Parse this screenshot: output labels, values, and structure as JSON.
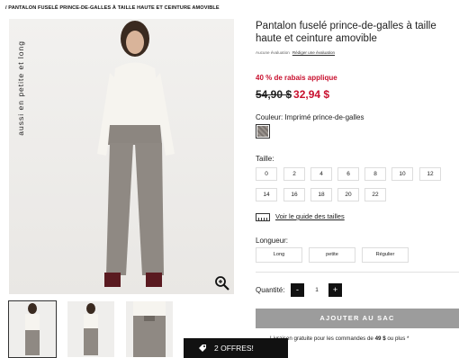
{
  "breadcrumb": "/  PANTALON FUSELÉ PRINCE-DE-GALLES À TAILLE HAUTE ET CEINTURE AMOVIBLE",
  "image": {
    "vertical_label": "aussi en petite et long"
  },
  "product": {
    "title": "Pantalon fuselé prince-de-galles à taille haute et ceinture amovible",
    "review_text": "Aucune évaluation",
    "review_link": "Rédiger une évaluation",
    "promo": "40 % de rabais applique",
    "old_price": "54,90 $",
    "new_price": "32,94 $"
  },
  "color": {
    "label": "Couleur: Imprimé prince-de-galles"
  },
  "sizes": {
    "label": "Taille:",
    "options": [
      "0",
      "2",
      "4",
      "6",
      "8",
      "10",
      "12",
      "14",
      "16",
      "18",
      "20",
      "22"
    ]
  },
  "size_guide": "Voir le guide des tailles",
  "length": {
    "label": "Longueur:",
    "options": [
      "Long",
      "petite",
      "Régulier"
    ]
  },
  "quantity": {
    "label": "Quantité:",
    "minus": "-",
    "value": "1",
    "plus": "+"
  },
  "cart": {
    "add_label": "AJOUTER AU SAC"
  },
  "shipping": {
    "prefix": "Livraison gratuite pour les commandes de ",
    "amount": "49 $",
    "suffix": " ou plus *"
  },
  "offers": {
    "label": "2 OFFRES!"
  },
  "colors": {
    "sale_red": "#c8102e",
    "button_grey": "#9c9c9c",
    "offers_black": "#111111"
  },
  "icons": [
    "zoom-icon",
    "ruler-icon",
    "tag-icon"
  ]
}
